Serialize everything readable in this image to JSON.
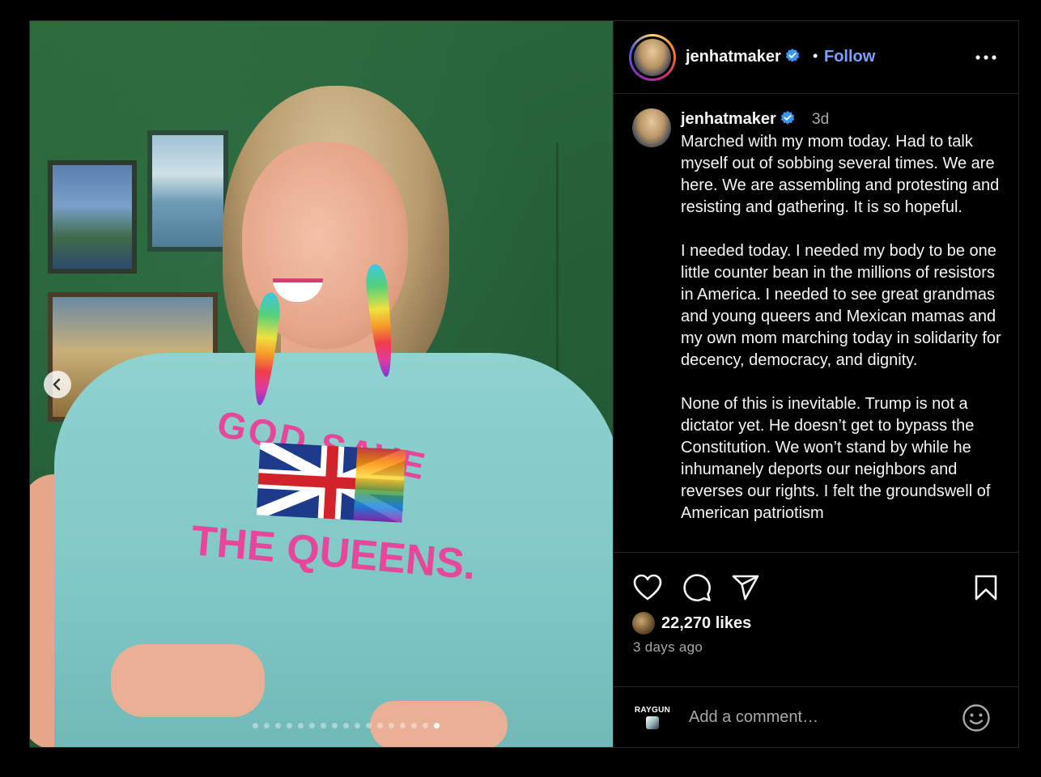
{
  "post": {
    "username": "jenhatmaker",
    "follow_label": "Follow",
    "separator": "•",
    "image_alt_shirt_line1": "GOD SAVE",
    "image_alt_shirt_line2": "THE QUEENS.",
    "carousel": {
      "total_slides": 17,
      "active_index": 16
    }
  },
  "caption": {
    "username": "jenhatmaker",
    "time": "3d",
    "paragraphs": [
      "Marched with my mom today. Had to talk myself out of sobbing several times. We are here. We are assembling and protesting and resisting and gathering. It is so hopeful.",
      "I needed today. I needed my body to be one little counter bean in the millions of resistors in America. I needed to see great grandmas and young queers and Mexican mamas and my own mom marching today in solidarity for decency, democracy, and dignity.",
      "None of this is inevitable. Trump is not a dictator yet. He doesn’t get to bypass the Constitution. We won’t stand by while he inhumanely deports our neighbors and reverses our rights. I felt the groundswell of American patriotism"
    ]
  },
  "engagement": {
    "likes": "22,270 likes",
    "date": "3 days ago"
  },
  "comment": {
    "avatar_brand": "RAYGUN",
    "placeholder": "Add a comment…"
  },
  "icons": {
    "like": "heart-icon",
    "comment": "comment-icon",
    "share": "share-icon",
    "save": "bookmark-icon",
    "more": "more-options-icon",
    "emoji": "emoji-icon",
    "verified": "verified-badge-icon",
    "prev": "chevron-left-icon"
  },
  "colors": {
    "background": "#000000",
    "text": "#f5f5f5",
    "muted": "#a8a8a8",
    "follow": "#7aa3ff",
    "verified": "#3897f0",
    "divider": "#262626"
  }
}
